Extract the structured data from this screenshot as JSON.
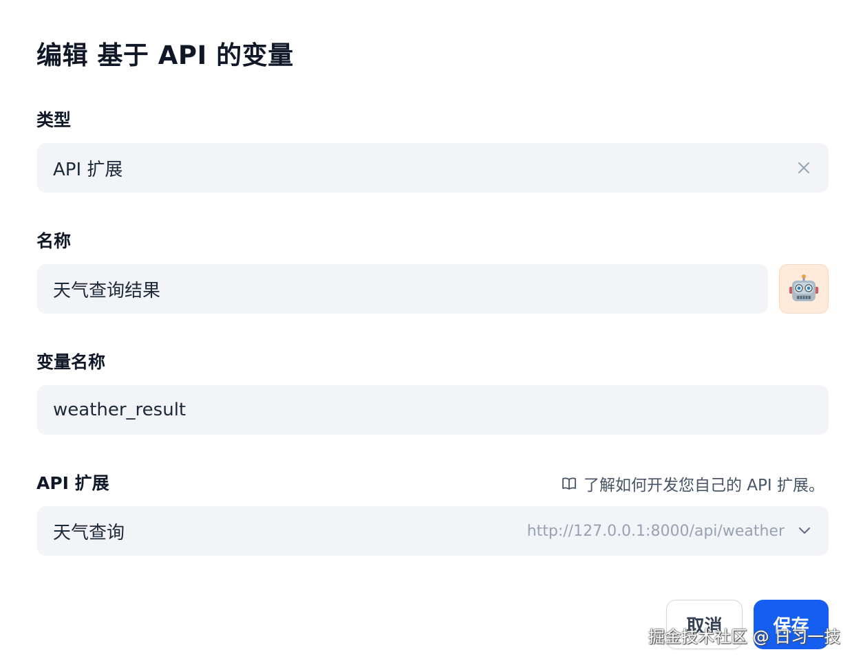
{
  "dialog": {
    "title": "编辑 基于 API 的变量"
  },
  "type_field": {
    "label": "类型",
    "value": "API 扩展"
  },
  "name_field": {
    "label": "名称",
    "value": "天气查询结果",
    "emoji": "🤖"
  },
  "variable_field": {
    "label": "变量名称",
    "value": "weather_result"
  },
  "api_extension": {
    "label": "API 扩展",
    "help_link": "了解如何开发您自己的 API 扩展。",
    "selected": "天气查询",
    "endpoint": "http://127.0.0.1:8000/api/weather"
  },
  "actions": {
    "cancel_label": "取消",
    "save_label": "保存"
  },
  "watermark": "掘金技术社区 @ 日习一技",
  "colors": {
    "primary": "#155eef",
    "field_bg": "#f2f4f7",
    "emoji_bg": "#fdeadb"
  }
}
